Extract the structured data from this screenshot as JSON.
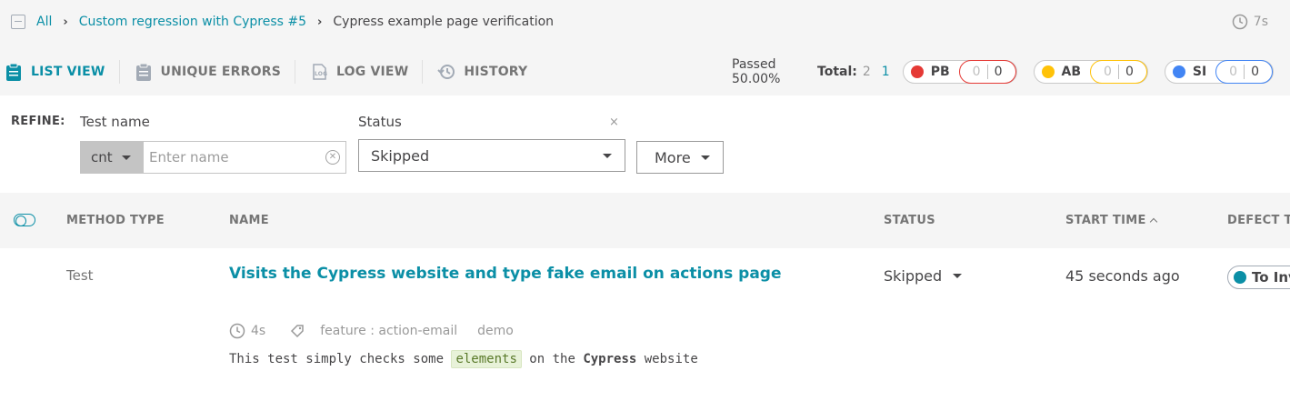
{
  "breadcrumb": {
    "items": [
      {
        "label": "All"
      },
      {
        "label": "Custom regression with Cypress #5"
      },
      {
        "label": "Cypress example page verification"
      }
    ]
  },
  "duration": "7s",
  "tabs": [
    {
      "label": "LIST VIEW",
      "icon": "clipboard-icon",
      "active": true
    },
    {
      "label": "UNIQUE ERRORS",
      "icon": "clipboard-icon",
      "active": false
    },
    {
      "label": "LOG VIEW",
      "icon": "log-icon",
      "active": false
    },
    {
      "label": "HISTORY",
      "icon": "history-icon",
      "active": false
    }
  ],
  "stats": {
    "passed": "Passed 50.00%",
    "total_label": "Total:",
    "total_a": "2",
    "total_b": "1",
    "defects": [
      {
        "name": "PB",
        "a": "0",
        "b": "0",
        "color": "#e53935"
      },
      {
        "name": "AB",
        "a": "0",
        "b": "0",
        "color": "#ffc208"
      },
      {
        "name": "SI",
        "a": "0",
        "b": "0",
        "color": "#4285f4"
      }
    ]
  },
  "refine": {
    "label": "REFINE:",
    "test_name_label": "Test name",
    "condition": "cnt",
    "name_placeholder": "Enter name",
    "status_label": "Status",
    "status_value": "Skipped",
    "close": "×",
    "more_label": "More"
  },
  "table": {
    "headers": {
      "method_type": "METHOD TYPE",
      "name": "NAME",
      "status": "STATUS",
      "start_time": "START TIME",
      "defect_type": "DEFECT TY"
    },
    "row": {
      "method_type": "Test",
      "name": "Visits the Cypress website and type fake email on actions page",
      "status": "Skipped",
      "start_time": "45 seconds ago",
      "defect": "To Inv",
      "duration": "4s",
      "attribute": "feature : action-email",
      "tag": "demo",
      "description": {
        "part1": "This test simply checks some ",
        "code": "elements",
        "part2": " on the ",
        "bold": "Cypress",
        "part3": " website"
      }
    }
  },
  "colors": {
    "accent": "#0b8fa6",
    "to_investigate": "#0b8fa6"
  }
}
